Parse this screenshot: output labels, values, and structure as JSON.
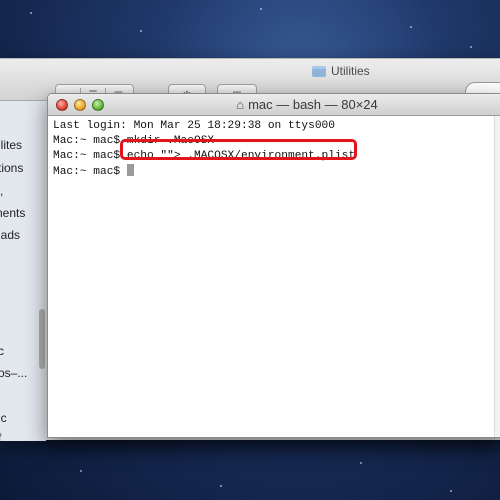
{
  "finder": {
    "title": "Utilities",
    "toolbar": {
      "view_icon": "▭▭",
      "list_icon": "☰",
      "column_icon": "▥",
      "gear_icon": "✲",
      "arrange_icon": "▦"
    },
    "sidebar_items": [
      "ilites",
      "tions",
      ",",
      "nents",
      "iads",
      "c",
      "os–...",
      "ic",
      "f"
    ],
    "bottom_text": ""
  },
  "terminal": {
    "title": "mac — bash — 80×24",
    "lines": [
      "Last login: Mon Mar 25 18:29:38 on ttys000",
      "Mac:~ mac$ mkdir .MacOSX",
      "Mac:~ mac$ echo \"\"> .MACOSX/environment.plist",
      "Mac:~ mac$ "
    ]
  },
  "colors": {
    "highlight": "#e2141c",
    "close": "#e0443a",
    "minimize": "#e8a72c",
    "zoom": "#5fb83c"
  }
}
